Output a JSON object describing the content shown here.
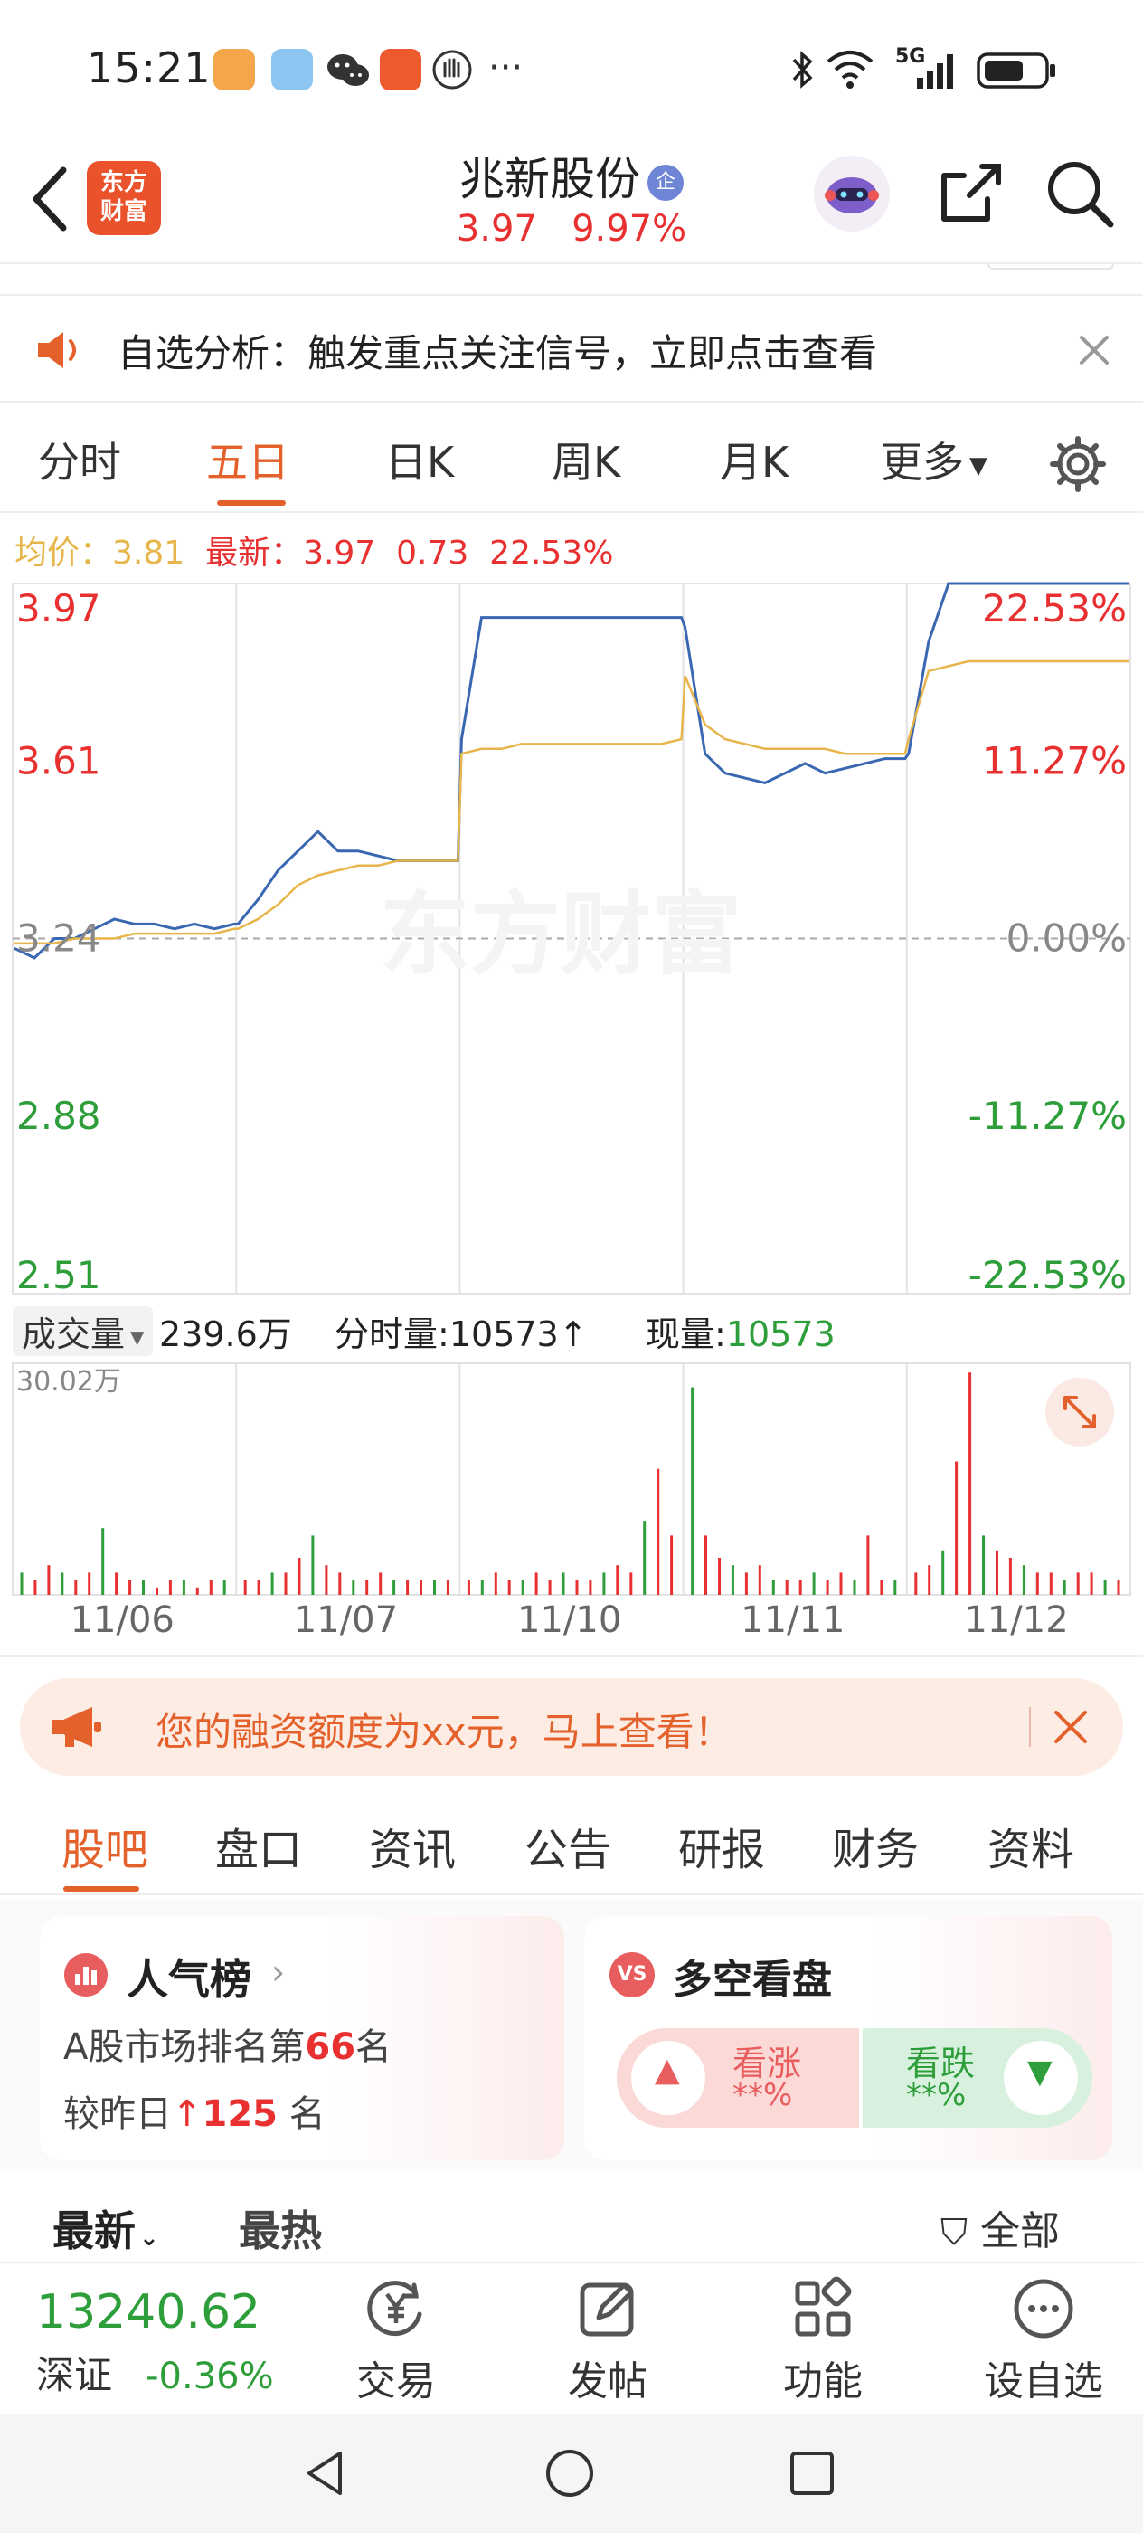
{
  "status_bar": {
    "time": "15:21",
    "network": "5G",
    "more_glyph": "···"
  },
  "header": {
    "logo_text_line1": "东方",
    "logo_text_line2": "财富",
    "stock_name": "兆新股份",
    "badge": "企",
    "price": "3.97",
    "change_pct": "9.97%"
  },
  "banner": {
    "text": "自选分析：触发重点关注信号，立即点击查看"
  },
  "tabs": {
    "items": [
      "分时",
      "五日",
      "日K",
      "周K",
      "月K",
      "更多"
    ],
    "active": "五日"
  },
  "info_line": {
    "avg_label": "均价：",
    "avg_value": "3.81",
    "latest_label": "最新：",
    "latest_value": "3.97",
    "change": "0.73",
    "change_pct": "22.53%"
  },
  "chart_data": [
    {
      "type": "line",
      "title": "",
      "left_axis": [
        "3.97",
        "3.61",
        "3.24",
        "2.88",
        "2.51"
      ],
      "right_axis": [
        "22.53%",
        "11.27%",
        "0.00%",
        "-11.27%",
        "-22.53%"
      ],
      "ylim": [
        2.51,
        3.97
      ],
      "baseline": 3.24,
      "x": [
        "11/06",
        "11/07",
        "11/10",
        "11/11",
        "11/12"
      ],
      "watermark": "东方财富",
      "series": [
        {
          "name": "最新",
          "color": "#3a67b1",
          "values": [
            [
              3.22,
              3.2,
              3.24,
              3.24,
              3.26,
              3.28,
              3.27,
              3.27,
              3.26,
              3.27,
              3.26,
              3.27
            ],
            [
              3.27,
              3.32,
              3.38,
              3.42,
              3.46,
              3.42,
              3.42,
              3.41,
              3.4,
              3.4,
              3.4,
              3.4
            ],
            [
              3.65,
              3.9,
              3.9,
              3.9,
              3.9,
              3.9,
              3.9,
              3.9,
              3.9,
              3.9,
              3.9,
              3.9
            ],
            [
              3.88,
              3.62,
              3.58,
              3.57,
              3.56,
              3.58,
              3.6,
              3.58,
              3.59,
              3.6,
              3.61,
              3.61
            ],
            [
              3.62,
              3.85,
              3.97,
              3.97,
              3.97,
              3.97,
              3.97,
              3.97,
              3.97,
              3.97,
              3.97,
              3.97
            ]
          ]
        },
        {
          "name": "均价",
          "color": "#e7b54a",
          "values": [
            [
              3.23,
              3.23,
              3.23,
              3.24,
              3.24,
              3.24,
              3.25,
              3.25,
              3.25,
              3.25,
              3.25,
              3.26
            ],
            [
              3.26,
              3.28,
              3.31,
              3.35,
              3.37,
              3.38,
              3.39,
              3.39,
              3.4,
              3.4,
              3.4,
              3.4
            ],
            [
              3.62,
              3.63,
              3.63,
              3.64,
              3.64,
              3.64,
              3.64,
              3.64,
              3.64,
              3.64,
              3.64,
              3.65
            ],
            [
              3.78,
              3.68,
              3.65,
              3.64,
              3.63,
              3.63,
              3.63,
              3.63,
              3.62,
              3.62,
              3.62,
              3.62
            ],
            [
              3.65,
              3.79,
              3.8,
              3.81,
              3.81,
              3.81,
              3.81,
              3.81,
              3.81,
              3.81,
              3.81,
              3.81
            ]
          ]
        }
      ]
    },
    {
      "type": "bar",
      "title": "",
      "max_label": "30.02万",
      "ylim": [
        0,
        30.02
      ],
      "unit": "万",
      "colors": {
        "up": "#e93030",
        "down": "#2e9e3a"
      },
      "volumes": [
        [
          3,
          2,
          4,
          3,
          2,
          3,
          9,
          3,
          2,
          2,
          1,
          2,
          2,
          1,
          2,
          2
        ],
        [
          2,
          2,
          3,
          3,
          5,
          8,
          4,
          3,
          2,
          2,
          3,
          2,
          2,
          2,
          2,
          2
        ],
        [
          2,
          2,
          3,
          2,
          2,
          3,
          2,
          3,
          2,
          2,
          3,
          4,
          3,
          10,
          17,
          8
        ],
        [
          28,
          8,
          5,
          4,
          3,
          4,
          2,
          2,
          2,
          3,
          2,
          3,
          2,
          8,
          2,
          2
        ],
        [
          3,
          4,
          6,
          18,
          30,
          8,
          6,
          5,
          4,
          3,
          3,
          2,
          3,
          3,
          2,
          2
        ]
      ]
    }
  ],
  "volume_bar": {
    "label": "成交量",
    "total": "239.6万",
    "fenshi_label": "分时量:",
    "fenshi_value": "10573",
    "arrow": "↑",
    "xian_label": "现量:",
    "xian_value": "10573"
  },
  "margin_banner": {
    "text": "您的融资额度为xx元，马上查看！"
  },
  "section_tabs": {
    "items": [
      "股吧",
      "盘口",
      "资讯",
      "公告",
      "研报",
      "财务",
      "资料"
    ],
    "active": "股吧"
  },
  "cards": {
    "popularity": {
      "title": "人气榜",
      "line1_prefix": "A股市场排名第",
      "rank": "66",
      "line1_suffix": "名",
      "line2_prefix": "较昨日",
      "change": "125",
      "line2_suffix": "名"
    },
    "sentiment": {
      "title": "多空看盘",
      "badge": "VS",
      "up_label": "看涨",
      "up_value": "**%",
      "down_label": "看跌",
      "down_value": "**%"
    }
  },
  "filter_row": {
    "latest": "最新",
    "hot": "最热",
    "all": "全部"
  },
  "bottom_bar": {
    "index_value": "13240.62",
    "index_name": "深证",
    "index_change": "-0.36%",
    "items": [
      "交易",
      "发帖",
      "功能",
      "设自选"
    ]
  },
  "colors": {
    "up": "#e93030",
    "down": "#2e9e3a",
    "accent": "#e4612b",
    "price_line": "#3a67b1",
    "avg_line": "#e7b54a"
  }
}
